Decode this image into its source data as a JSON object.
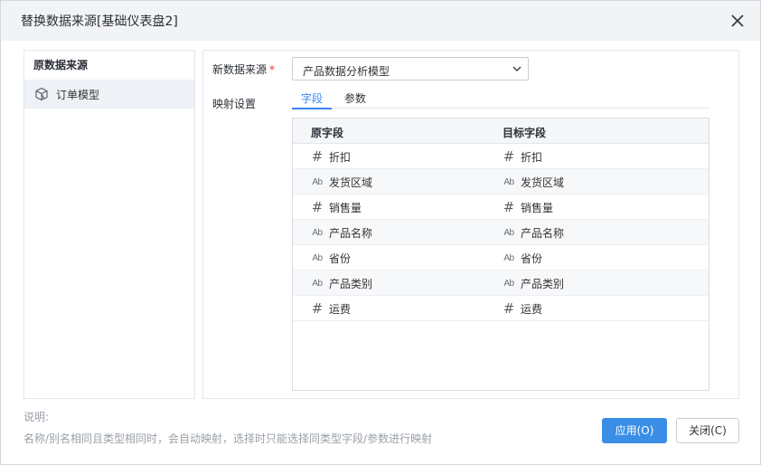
{
  "dialog": {
    "title": "替换数据来源[基础仪表盘2]",
    "close_icon": "close-icon"
  },
  "left": {
    "header": "原数据来源",
    "items": [
      {
        "label": "订单模型",
        "icon": "cube-model-icon"
      }
    ]
  },
  "right": {
    "new_source_label": "新数据来源",
    "required_mark": "*",
    "select_value": "产品数据分析模型",
    "mapping_label": "映射设置",
    "tabs": [
      {
        "label": "字段",
        "active": true
      },
      {
        "label": "参数",
        "active": false
      }
    ],
    "table": {
      "headers": [
        "原字段",
        "目标字段"
      ],
      "rows": [
        {
          "src_type": "number",
          "src": "折扣",
          "dst_type": "number",
          "dst": "折扣"
        },
        {
          "src_type": "string",
          "src": "发货区域",
          "dst_type": "string",
          "dst": "发货区域"
        },
        {
          "src_type": "number",
          "src": "销售量",
          "dst_type": "number",
          "dst": "销售量"
        },
        {
          "src_type": "string",
          "src": "产品名称",
          "dst_type": "string",
          "dst": "产品名称"
        },
        {
          "src_type": "string",
          "src": "省份",
          "dst_type": "string",
          "dst": "省份"
        },
        {
          "src_type": "string",
          "src": "产品类别",
          "dst_type": "string",
          "dst": "产品类别"
        },
        {
          "src_type": "number",
          "src": "运费",
          "dst_type": "number",
          "dst": "运费"
        }
      ]
    }
  },
  "notes": {
    "title": "说明:",
    "text": "名称/别名相同且类型相同时，会自动映射，选择时只能选择同类型字段/参数进行映射"
  },
  "buttons": {
    "apply": "应用(O)",
    "close": "关闭(C)"
  },
  "type_glyphs": {
    "number": "#",
    "string": "Ab"
  },
  "colors": {
    "accent": "#3685f2",
    "apply_button": "#3a8ee6",
    "required": "#e5373b",
    "selected_item_bg": "#eef2f7"
  }
}
